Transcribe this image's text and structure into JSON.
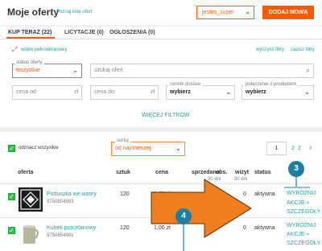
{
  "header": {
    "title": "Moje oferty",
    "help_link": "Poznaj listę ofert",
    "account_select": "jestes_super",
    "add_button": "DODAJ NOWĄ"
  },
  "tabs": [
    {
      "label": "KUP TERAZ (22)",
      "active": true
    },
    {
      "label": "LICYTACJE (0)",
      "active": false
    },
    {
      "label": "OGŁOSZENIA (0)",
      "active": false
    }
  ],
  "filters": {
    "fullscreen_link": "widok pełnoekranowy",
    "clear_link": "wyczyść filtry",
    "save_link": "zapisz filtry",
    "status_label": "status oferty",
    "status_value": "wszystkie",
    "search_placeholder": "szukaj ofert",
    "price_from": "cena od",
    "price_to": "cena do",
    "currency_symbol": "zł",
    "shipping_label": "cennik dostaw",
    "shipping_value": "wybierz",
    "product_link_label": "połączenie z produktem",
    "product_link_value": "wybierz",
    "more_filters": "WIĘCEJ FILTRÓW"
  },
  "list": {
    "select_all": "odznacz wszystkie",
    "sort_label": "sortuj",
    "sort_value": "od najnowszej",
    "page_current": "1",
    "page_link": "2",
    "page_total": "2"
  },
  "table": {
    "headers": {
      "offer": "oferta",
      "quantity": "sztuk",
      "price": "cena",
      "sold": "sprzedano",
      "sold_sub": "30 dni",
      "watch": "obs.",
      "visits": "wizyt",
      "visits_sub": "30 dni",
      "status": "status"
    },
    "rows": [
      {
        "name": "Poduszka we wzory",
        "id": "9750854983",
        "quantity": "120",
        "price": "12,00 zł",
        "visits": "0",
        "status": "aktywna",
        "actions": [
          "WYRÓŻNIJ",
          "AKCJE",
          "SZCZEGÓŁY"
        ]
      },
      {
        "name": "Kubek porcelanowy",
        "id": "9750854981",
        "quantity": "120",
        "price": "1,00 zł",
        "visits": "0",
        "status": "aktywna",
        "actions": [
          "WYRÓŻNIJ",
          "AKCJE",
          "SZCZEGÓŁY"
        ]
      }
    ]
  },
  "annotations": {
    "badge_3": "3",
    "badge_4": "4",
    "badge_color": "#1e7fa3",
    "arrow_color": "#f07f1e"
  },
  "colors": {
    "accent": "#1aa3a3",
    "brand": "#ff5a00",
    "checkbox": "#2dbf4a"
  }
}
